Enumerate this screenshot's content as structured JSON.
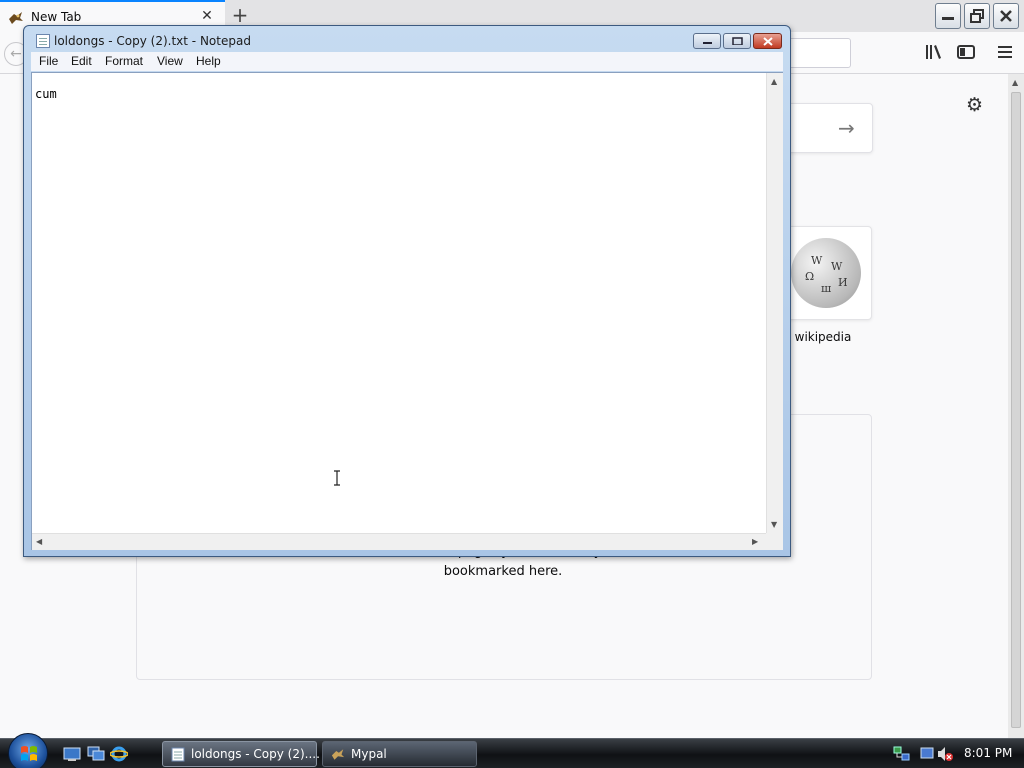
{
  "browser": {
    "tab_title": "New Tab",
    "tab_close": "✕",
    "newtab": "+",
    "topsite_label": "wikipedia",
    "highlights_text": "videos, and other pages you've recently visited or bookmarked here.",
    "search_arrow": "→",
    "back": "←"
  },
  "notepad": {
    "title": "loldongs - Copy (2).txt - Notepad",
    "menu": [
      "File",
      "Edit",
      "Format",
      "View",
      "Help"
    ],
    "content": "cum"
  },
  "taskbar": {
    "buttons": [
      "loldongs - Copy (2)....",
      "Mypal"
    ],
    "clock": "8:01 PM"
  },
  "colors": {
    "accent": "#0a84ff",
    "notepad_frame": "#a9c5e6",
    "close_red": "#c13a22"
  },
  "icons": [
    "mypal-icon",
    "library-icon",
    "sidebar-icon",
    "menu-icon",
    "gear-icon",
    "wikipedia-globe-icon",
    "notepad-icon",
    "windows-start-icon",
    "internet-explorer-icon",
    "network-icon",
    "volume-muted-icon"
  ]
}
